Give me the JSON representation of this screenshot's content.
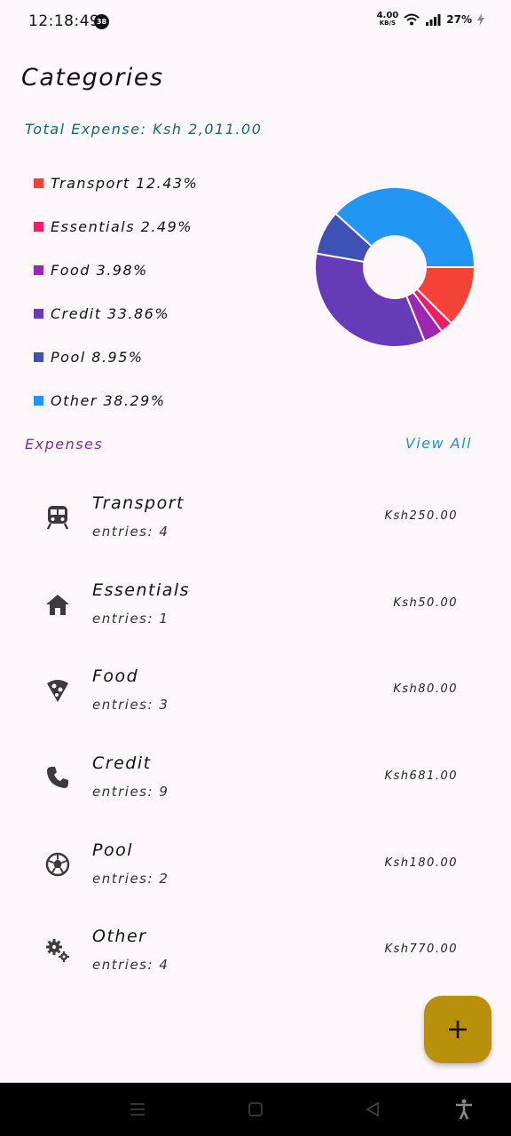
{
  "status_bar": {
    "time": "12:18:49",
    "notification_count": "38",
    "net_speed_value": "4.00",
    "net_speed_unit": "KB/S",
    "battery": "27%"
  },
  "header": {
    "title": "Categories",
    "total_expense": "Total Expense: Ksh 2,011.00"
  },
  "legend": [
    {
      "label": "Transport 12.43%",
      "color": "#f44336"
    },
    {
      "label": "Essentials 2.49%",
      "color": "#e91e63"
    },
    {
      "label": "Food 3.98%",
      "color": "#9c27b0"
    },
    {
      "label": "Credit 33.86%",
      "color": "#673ab7"
    },
    {
      "label": "Pool 8.95%",
      "color": "#3f51b5"
    },
    {
      "label": "Other 38.29%",
      "color": "#2196f3"
    }
  ],
  "chart_data": {
    "type": "pie",
    "categories": [
      "Transport",
      "Essentials",
      "Food",
      "Credit",
      "Pool",
      "Other"
    ],
    "values": [
      12.43,
      2.49,
      3.98,
      33.86,
      8.95,
      38.29
    ],
    "colors": [
      "#f44336",
      "#e91e63",
      "#9c27b0",
      "#673ab7",
      "#3f51b5",
      "#2196f3"
    ],
    "donut": true
  },
  "expenses_section": {
    "title": "Expenses",
    "view_all": "View All"
  },
  "expenses": [
    {
      "name": "Transport",
      "entries": "entries: 4",
      "amount": "Ksh250.00",
      "icon": "train-icon"
    },
    {
      "name": "Essentials",
      "entries": "entries: 1",
      "amount": "Ksh50.00",
      "icon": "home-icon"
    },
    {
      "name": "Food",
      "entries": "entries: 3",
      "amount": "Ksh80.00",
      "icon": "pizza-icon"
    },
    {
      "name": "Credit",
      "entries": "entries: 9",
      "amount": "Ksh681.00",
      "icon": "phone-icon"
    },
    {
      "name": "Pool",
      "entries": "entries: 2",
      "amount": "Ksh180.00",
      "icon": "ball-icon"
    },
    {
      "name": "Other",
      "entries": "entries: 4",
      "amount": "Ksh770.00",
      "icon": "gears-icon"
    }
  ],
  "fab": {
    "icon": "add-icon"
  },
  "nav_bar": {
    "icons": [
      "menu-icon",
      "home-icon",
      "back-icon",
      "accessibility-icon"
    ]
  }
}
